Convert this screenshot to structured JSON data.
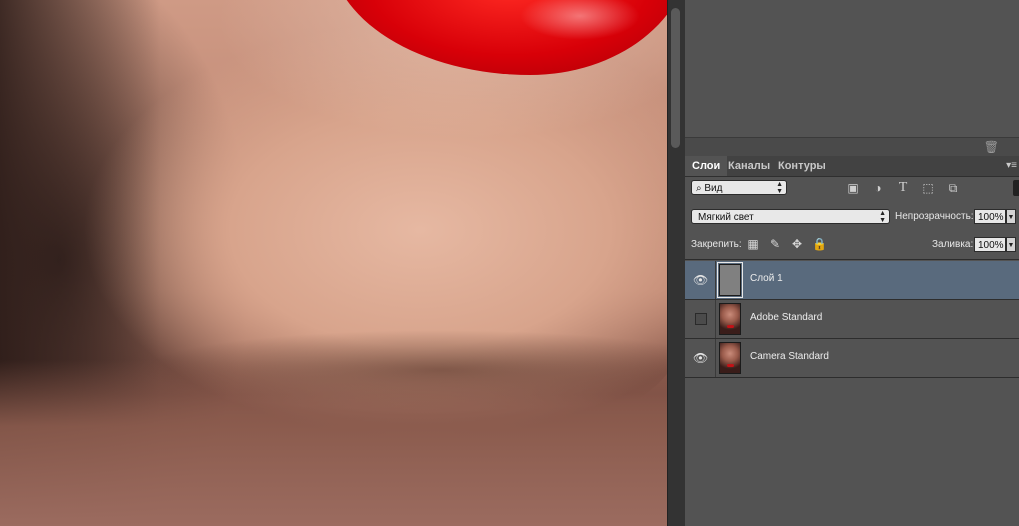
{
  "layers_panel": {
    "tabs": [
      "Слои",
      "Каналы",
      "Контуры"
    ],
    "filter": {
      "label": "Вид"
    },
    "filter_icons": [
      "image-filter-icon",
      "adjustment-filter-icon",
      "type-filter-icon",
      "shape-filter-icon",
      "smart-object-filter-icon"
    ],
    "blend_mode": "Мягкий свет",
    "opacity_label": "Непрозрачность:",
    "opacity_value": "100%",
    "lock_label": "Закрепить:",
    "lock_icons": [
      "lock-transparent-pixels-icon",
      "lock-image-pixels-icon",
      "lock-position-icon",
      "lock-all-icon"
    ],
    "fill_label": "Заливка:",
    "fill_value": "100%",
    "layers": [
      {
        "name": "Слой 1",
        "visible": true,
        "selected": true,
        "thumbnail": "gray-fill"
      },
      {
        "name": "Adobe Standard",
        "visible": false,
        "selected": false,
        "thumbnail": "portrait-photo"
      },
      {
        "name": "Camera Standard",
        "visible": true,
        "selected": false,
        "thumbnail": "portrait-photo"
      }
    ]
  },
  "colors": {
    "panel": "#535353",
    "selected_layer": "#596a7d",
    "lipstick": "#e0000a"
  }
}
